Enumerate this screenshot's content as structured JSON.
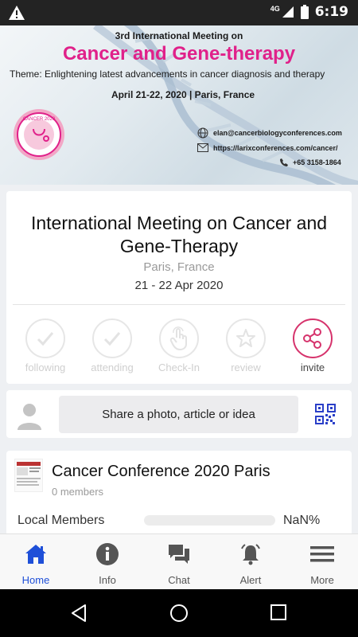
{
  "status_bar": {
    "network": "4G",
    "time": "6:19"
  },
  "banner": {
    "line1": "3rd International Meeting on",
    "line2": "Cancer and Gene-therapy",
    "theme": "Theme: Enlightening latest advancements in cancer diagnosis and therapy",
    "dates": "April 21-22, 2020 | Paris, France",
    "email": "elan@cancerbiologyconferences.com",
    "url": "https://larixconferences.com/cancer/",
    "phone": "+65 3158-1864",
    "seal": {
      "top": "CANCER 2020",
      "bottom": "April 21-22, 2020 | Paris, France"
    }
  },
  "event": {
    "title": "International Meeting on Cancer and Gene-Therapy",
    "location": "Paris, France",
    "date": "21 - 22 Apr 2020"
  },
  "actions": [
    {
      "label": "following",
      "icon": "check-icon"
    },
    {
      "label": "attending",
      "icon": "check-icon"
    },
    {
      "label": "Check-In",
      "icon": "tap-icon"
    },
    {
      "label": "review",
      "icon": "star-icon"
    },
    {
      "label": "invite",
      "icon": "share-icon"
    }
  ],
  "share": {
    "placeholder": "Share a photo, article or idea"
  },
  "group": {
    "name": "Cancer Conference 2020 Paris",
    "members": "0 members",
    "local_label": "Local Members",
    "local_pct": "NaN%"
  },
  "nav": [
    {
      "label": "Home",
      "icon": "home-icon"
    },
    {
      "label": "Info",
      "icon": "info-icon"
    },
    {
      "label": "Chat",
      "icon": "chat-icon"
    },
    {
      "label": "Alert",
      "icon": "bell-icon"
    },
    {
      "label": "More",
      "icon": "menu-icon"
    }
  ],
  "colors": {
    "accent_pink": "#e0218a",
    "invite": "#d6336c",
    "nav_active": "#1e4fd8"
  }
}
